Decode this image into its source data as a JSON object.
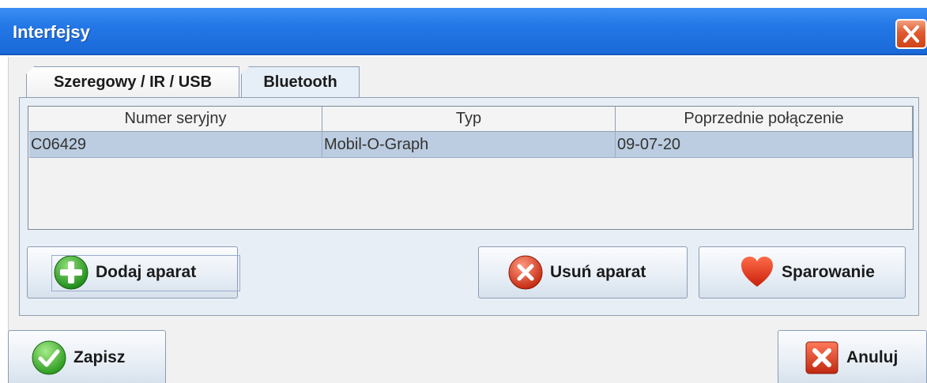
{
  "window": {
    "title": "Interfejsy"
  },
  "tabs": [
    {
      "label": "Szeregowy / IR / USB",
      "active": false
    },
    {
      "label": "Bluetooth",
      "active": true
    }
  ],
  "table": {
    "columns": [
      "Numer seryjny",
      "Typ",
      "Poprzednie połączenie"
    ],
    "rows": [
      {
        "serial": "C06429",
        "type": "Mobil-O-Graph",
        "last": "09-07-20",
        "selected": true
      }
    ]
  },
  "buttons": {
    "add": "Dodaj aparat",
    "remove": "Usuń aparat",
    "pair": "Sparowanie",
    "save": "Zapisz",
    "cancel": "Anuluj"
  },
  "icons": {
    "add": "plus-circle-icon",
    "remove": "x-circle-icon",
    "pair": "heart-icon",
    "save": "check-circle-icon",
    "cancel": "x-square-icon",
    "close": "close-icon"
  },
  "colors": {
    "titlebar": "#2377e6",
    "selected_row": "#bccde1",
    "close": "#e05a30"
  }
}
